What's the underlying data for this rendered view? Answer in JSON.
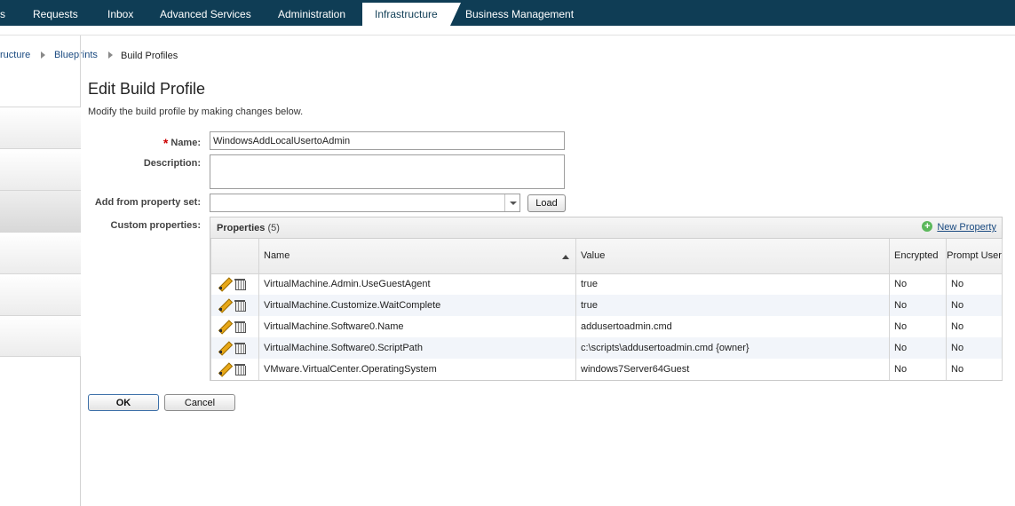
{
  "nav": {
    "items": [
      {
        "label": "s",
        "active": false
      },
      {
        "label": "Requests",
        "active": false
      },
      {
        "label": "Inbox",
        "active": false
      },
      {
        "label": "Advanced Services",
        "active": false
      },
      {
        "label": "Administration",
        "active": false
      },
      {
        "label": "Infrastructure",
        "active": true
      },
      {
        "label": "Business Management",
        "active": false
      }
    ]
  },
  "breadcrumb": {
    "items": [
      "ructure",
      "Blueprints",
      "Build Profiles"
    ]
  },
  "page": {
    "title": "Edit Build Profile",
    "subtitle": "Modify the build profile by making changes below."
  },
  "form": {
    "name_label": "Name:",
    "name_value": "WindowsAddLocalUsertoAdmin",
    "description_label": "Description:",
    "description_value": "",
    "property_set_label": "Add from property set:",
    "property_set_value": "",
    "load_label": "Load",
    "custom_props_label": "Custom properties:"
  },
  "properties": {
    "title": "Properties",
    "count": "(5)",
    "new_label": "New Property",
    "columns": [
      "Name",
      "Value",
      "Encrypted",
      "Prompt User"
    ],
    "rows": [
      {
        "name": "VirtualMachine.Admin.UseGuestAgent",
        "value": "true",
        "encrypted": "No",
        "prompt": "No"
      },
      {
        "name": "VirtualMachine.Customize.WaitComplete",
        "value": "true",
        "encrypted": "No",
        "prompt": "No"
      },
      {
        "name": "VirtualMachine.Software0.Name",
        "value": "addusertoadmin.cmd",
        "encrypted": "No",
        "prompt": "No"
      },
      {
        "name": "VirtualMachine.Software0.ScriptPath",
        "value": "c:\\scripts\\addusertoadmin.cmd {owner}",
        "encrypted": "No",
        "prompt": "No"
      },
      {
        "name": "VMware.VirtualCenter.OperatingSystem",
        "value": "windows7Server64Guest",
        "encrypted": "No",
        "prompt": "No"
      }
    ]
  },
  "buttons": {
    "ok": "OK",
    "cancel": "Cancel"
  }
}
